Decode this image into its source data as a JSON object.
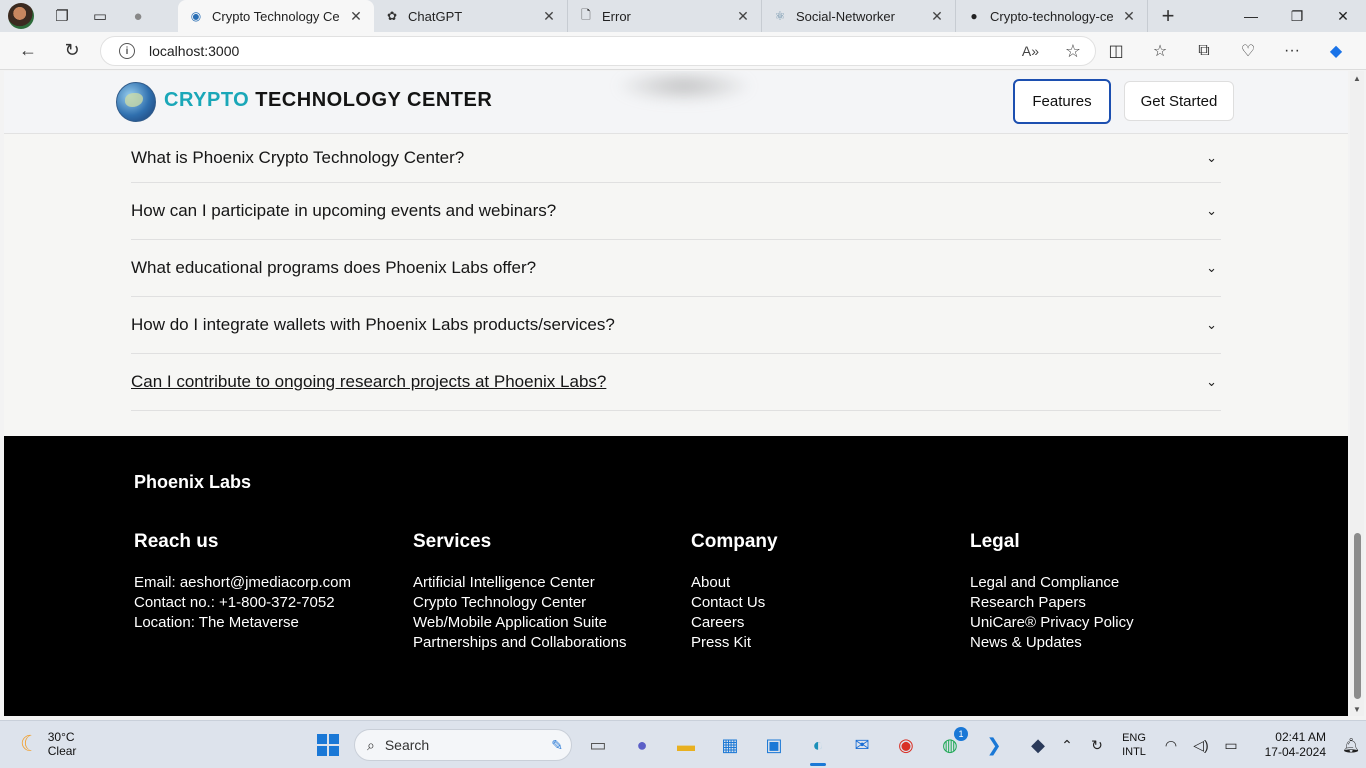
{
  "browser": {
    "tabs": [
      {
        "title": "Crypto Technology Cente",
        "icon": "globe-icon",
        "active": true
      },
      {
        "title": "ChatGPT",
        "icon": "chatgpt-icon",
        "active": false
      },
      {
        "title": "Error",
        "icon": "page-icon",
        "active": false
      },
      {
        "title": "Social-Networker",
        "icon": "react-icon",
        "active": false
      },
      {
        "title": "Crypto-technology-cent",
        "icon": "github-icon",
        "active": false
      }
    ],
    "url": "localhost:3000"
  },
  "site": {
    "brand_part1": "CRYPTO",
    "brand_part2": "TECHNOLOGY CENTER",
    "nav": {
      "features": "Features",
      "get_started": "Get Started"
    },
    "colors": {
      "brand_accent": "#1aa7b8",
      "focus_ring": "#1c4fb0",
      "footer_bg": "#000000"
    }
  },
  "faq": [
    {
      "question": "What is Phoenix Crypto Technology Center?"
    },
    {
      "question": "How can I participate in upcoming events and webinars?"
    },
    {
      "question": "What educational programs does Phoenix Labs offer?"
    },
    {
      "question": "How do I integrate wallets with Phoenix Labs products/services?"
    },
    {
      "question": "Can I contribute to ongoing research projects at Phoenix Labs?"
    }
  ],
  "footer": {
    "brand": "Phoenix Labs",
    "columns": [
      {
        "title": "Reach us",
        "items": [
          "Email: aeshort@jmediacorp.com",
          "Contact no.: +1-800-372-7052",
          "Location: The Metaverse"
        ]
      },
      {
        "title": "Services",
        "items": [
          "Artificial Intelligence Center",
          "Crypto Technology Center",
          "Web/Mobile Application Suite",
          "Partnerships and Collaborations"
        ]
      },
      {
        "title": "Company",
        "items": [
          "About",
          "Contact Us",
          "Careers",
          "Press Kit"
        ]
      },
      {
        "title": "Legal",
        "items": [
          "Legal and Compliance",
          "Research Papers",
          "UniCare® Privacy Policy",
          "News & Updates"
        ]
      }
    ]
  },
  "taskbar": {
    "weather_temp": "30°C",
    "weather_desc": "Clear",
    "search_placeholder": "Search",
    "whatsapp_badge": "1",
    "lang_line1": "ENG",
    "lang_line2": "INTL",
    "time": "02:41 AM",
    "date": "17-04-2024"
  }
}
